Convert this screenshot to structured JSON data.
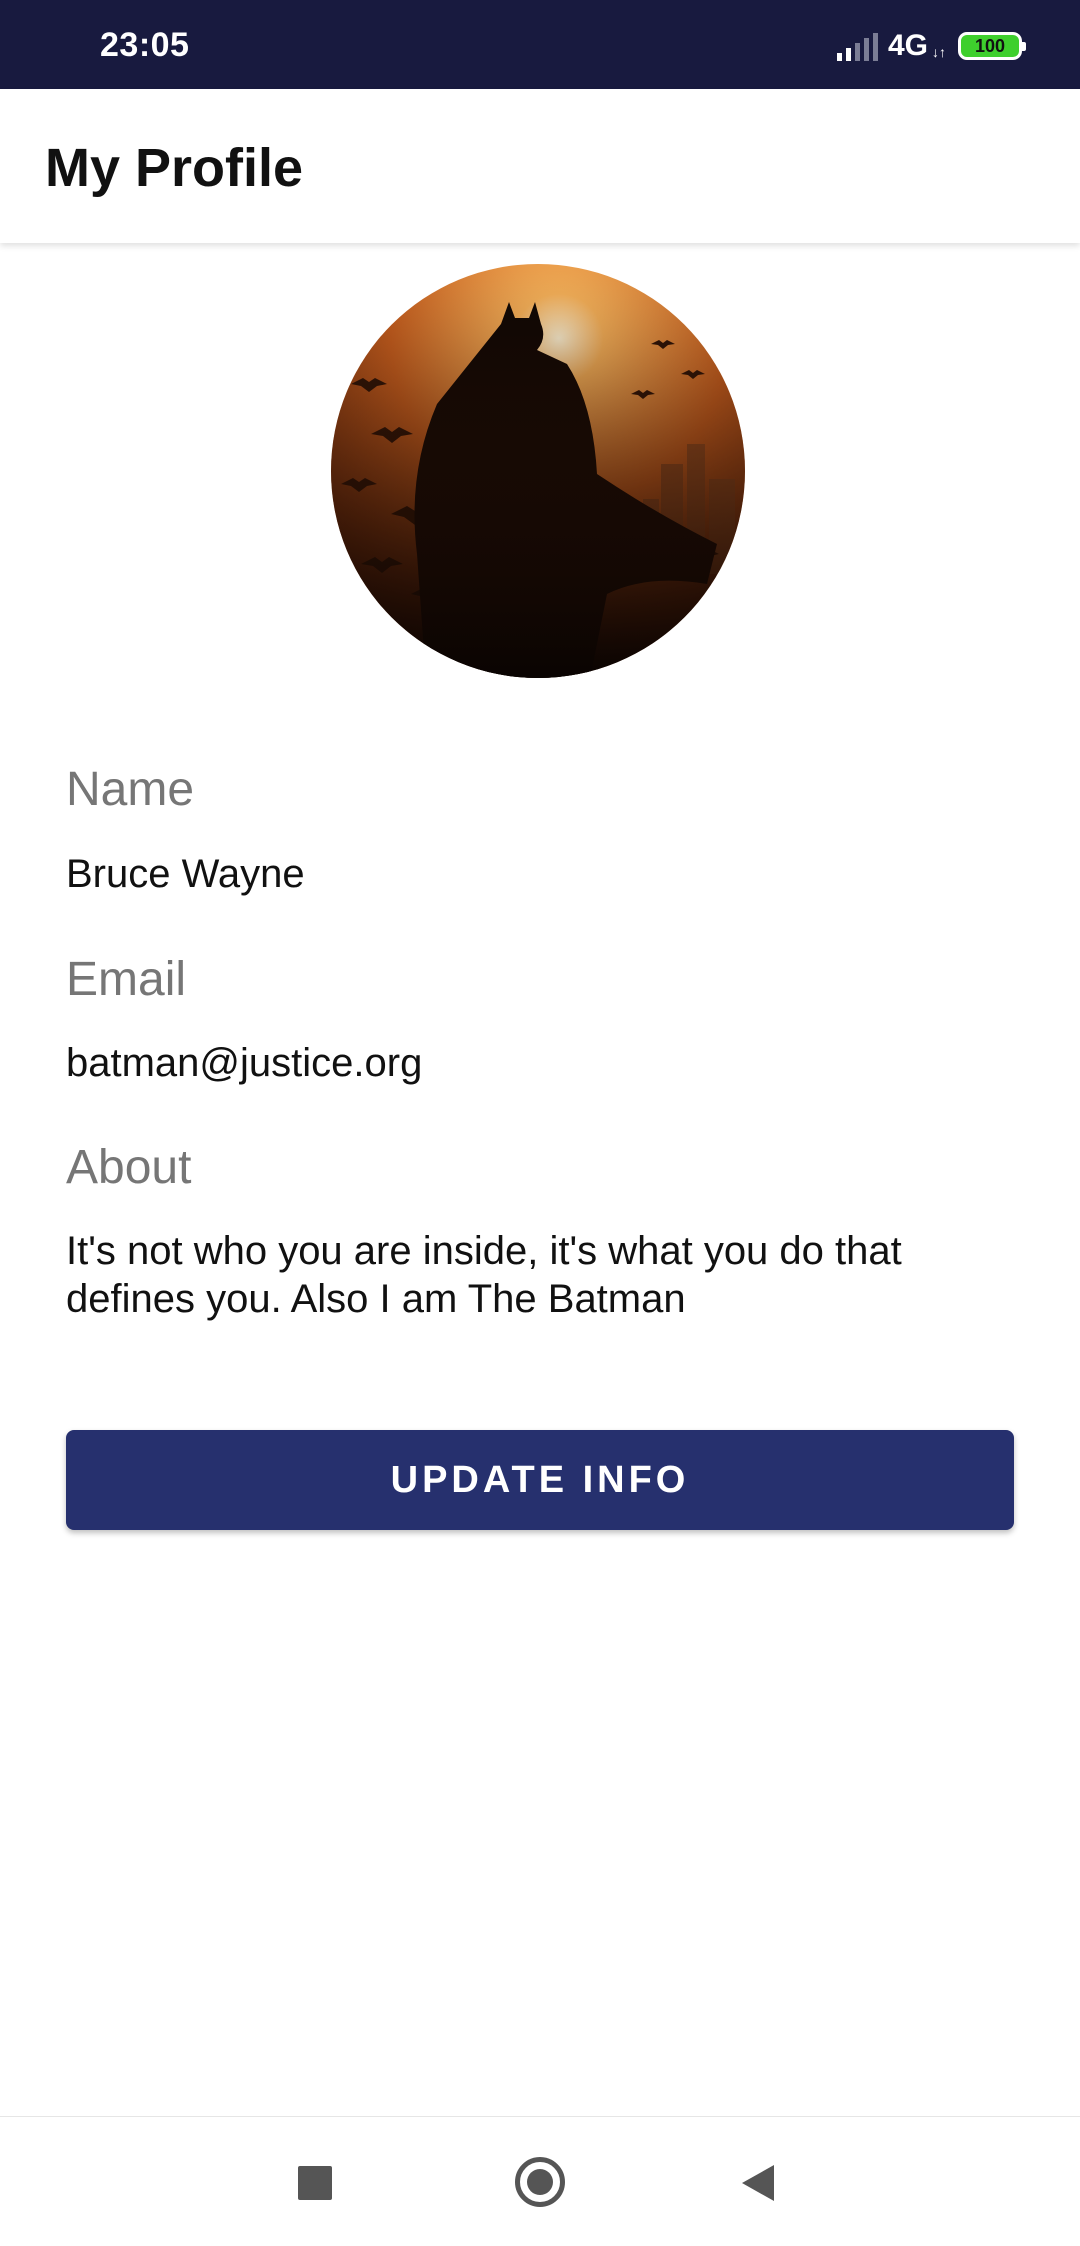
{
  "status_bar": {
    "time": "23:05",
    "network": "4G",
    "network_arrows": "↓↑",
    "battery": "100",
    "colors": {
      "background": "#181a3f",
      "battery": "#3ecf2d"
    }
  },
  "app_bar": {
    "title": "My Profile"
  },
  "profile": {
    "avatar_icon": "profile-photo-batman",
    "fields": [
      {
        "label": "Name",
        "value": "Bruce Wayne"
      },
      {
        "label": "Email",
        "value": "batman@justice.org"
      },
      {
        "label": "About",
        "value": "It's not who you are inside, it's what you do that defines you. Also I am The Batman"
      }
    ]
  },
  "actions": {
    "update_label": "UPDATE INFO",
    "accent_color": "#26306e"
  },
  "nav_bar": {
    "icons": [
      "recents-icon",
      "home-icon",
      "back-icon"
    ]
  }
}
